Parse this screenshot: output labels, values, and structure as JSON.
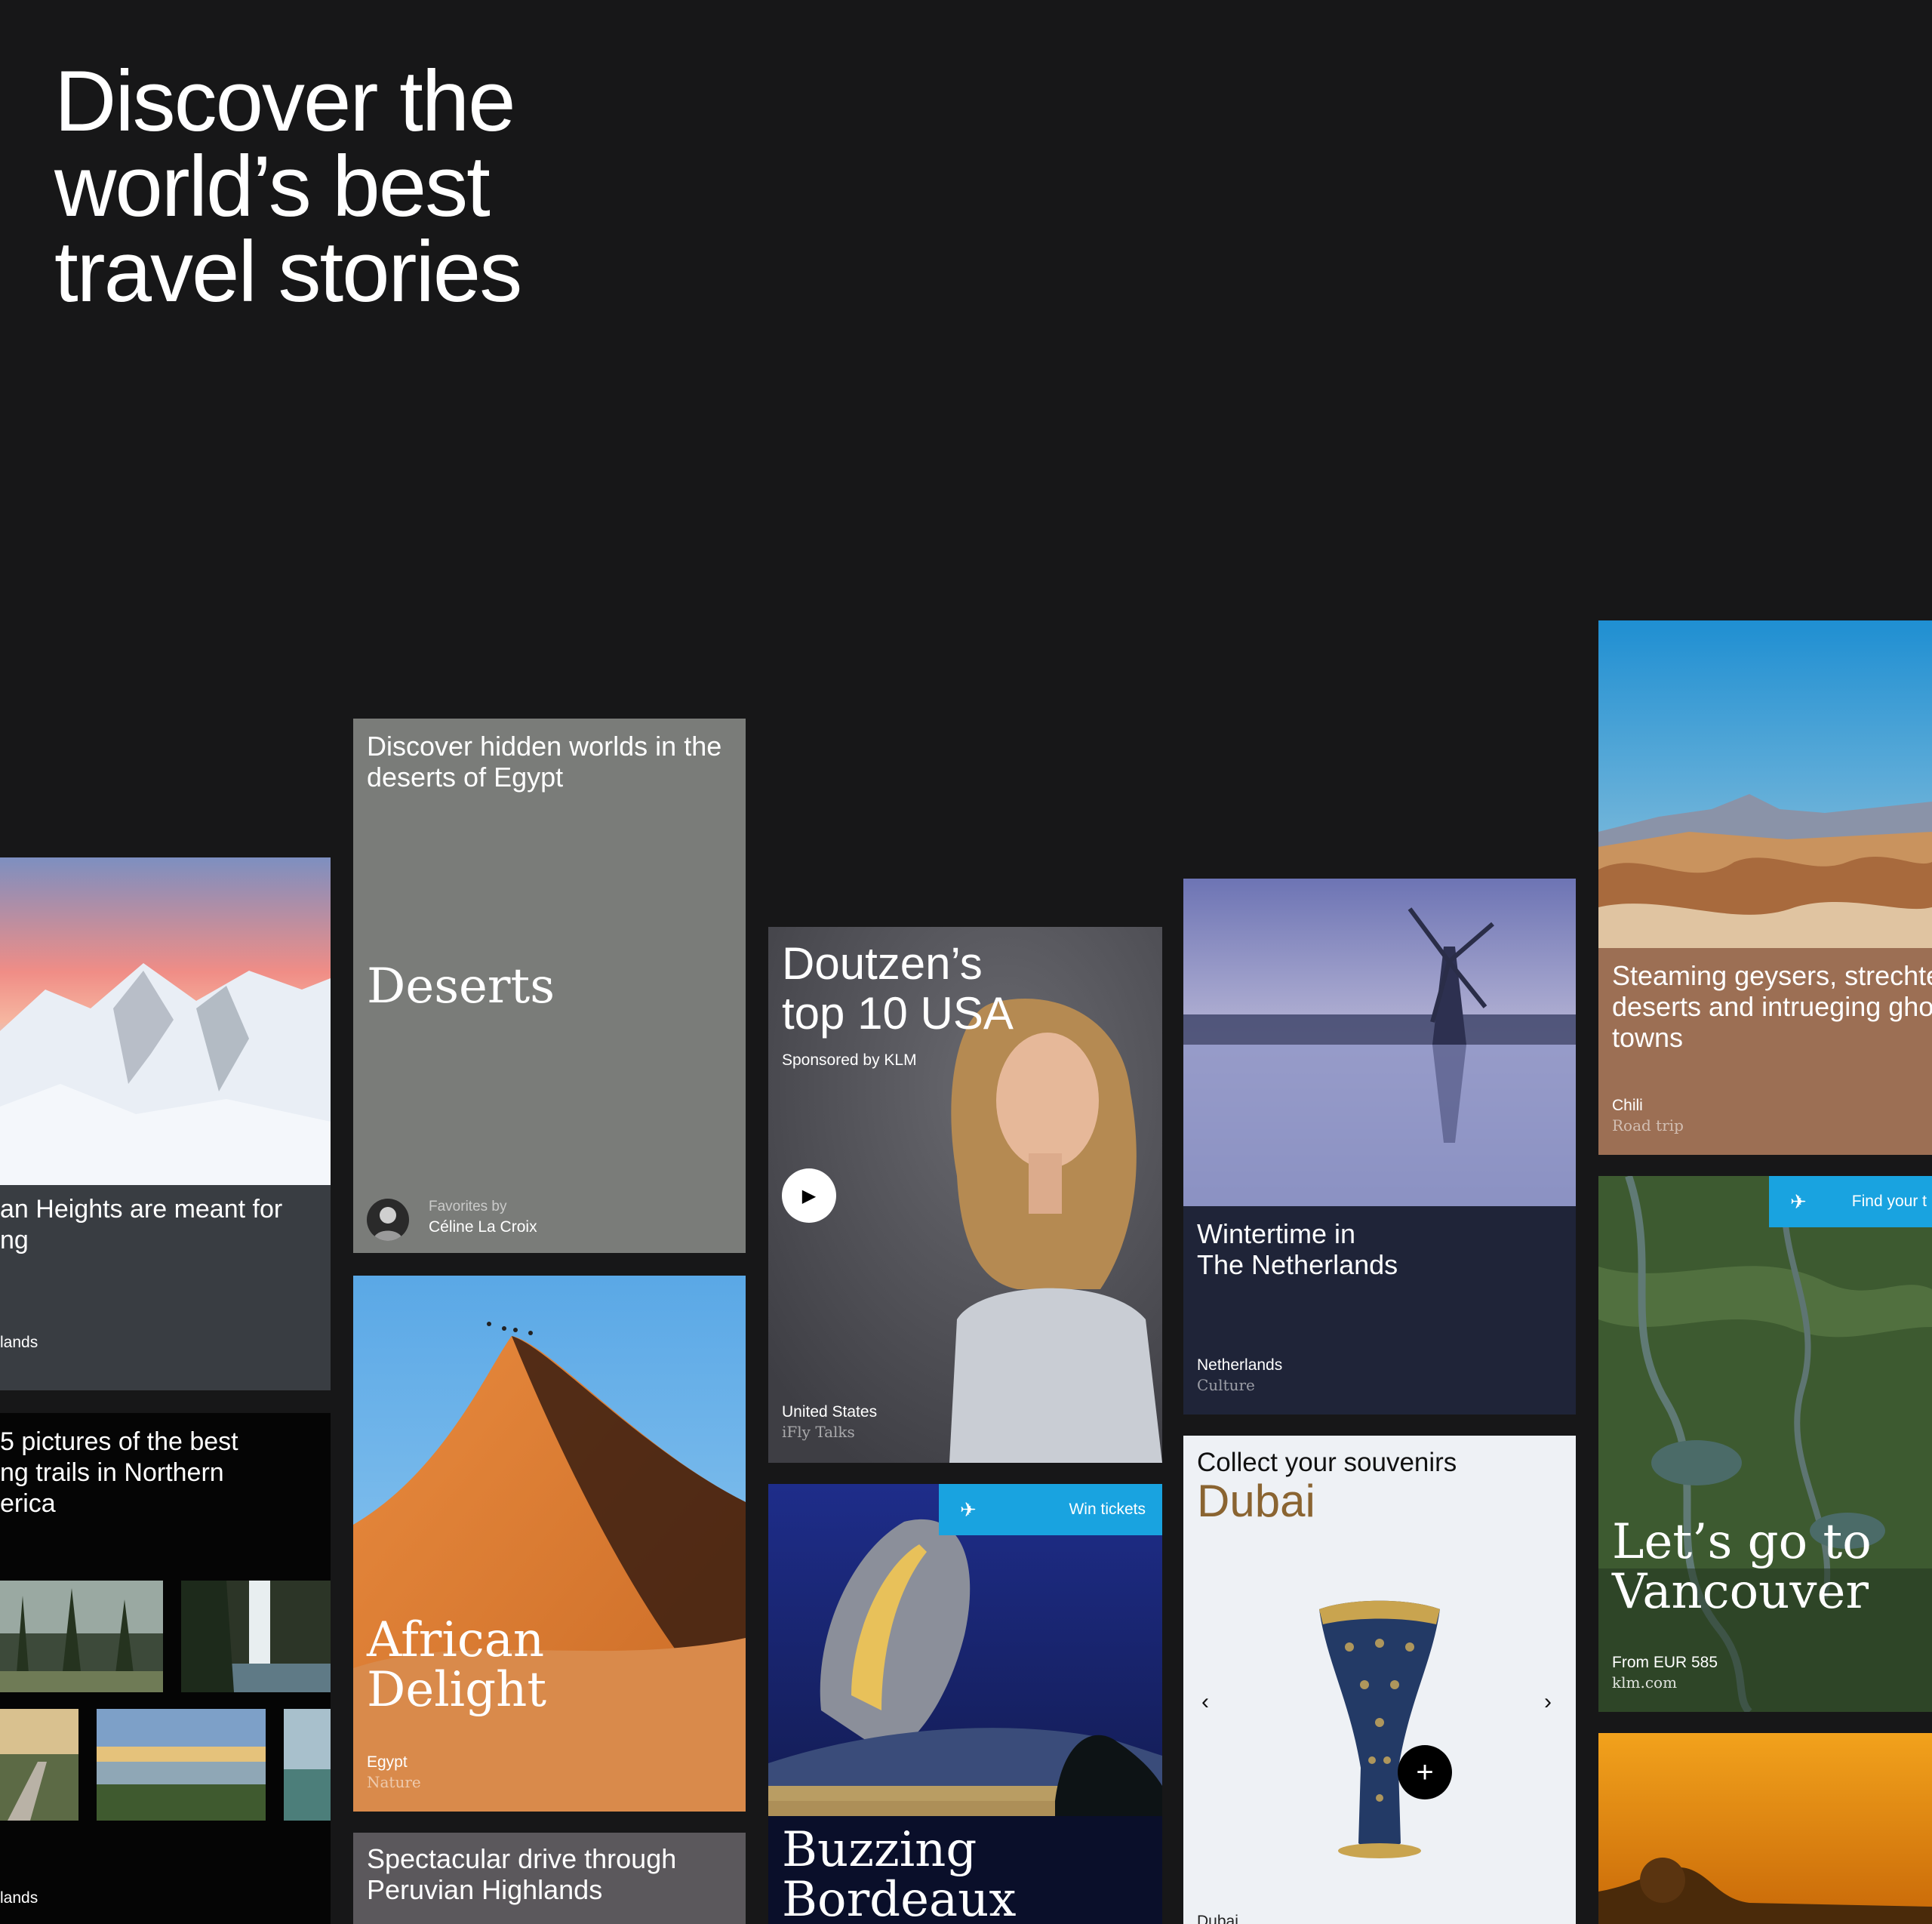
{
  "hero": {
    "title": "Discover the\nworld’s best\ntravel stories"
  },
  "cards": {
    "heights": {
      "title": "an Heights are meant for\nng",
      "location": "lands"
    },
    "trails": {
      "title": "5 pictures of the best\nng trails in Northern\nerica",
      "location": "lands"
    },
    "deserts": {
      "intro": "Discover hidden worlds in the\ndeserts of Egypt",
      "title": "Deserts",
      "favorites_label": "Favorites by",
      "author": "Céline La Croix"
    },
    "african": {
      "title": "African\nDelight",
      "location": "Egypt",
      "category": "Nature"
    },
    "peru": {
      "title": "Spectacular drive through\nPeruvian Highlands"
    },
    "doutzen": {
      "title": "Doutzen’s\ntop 10 USA",
      "sponsor": "Sponsored by KLM",
      "location": "United States",
      "category": "iFly Talks",
      "play_icon": "play-icon"
    },
    "bordeaux": {
      "ribbon": "Win tickets",
      "title": "Buzzing\nBordeaux"
    },
    "netherlands": {
      "title": "Wintertime in\nThe Netherlands",
      "location": "Netherlands",
      "category": "Culture"
    },
    "dubai": {
      "kicker": "Collect your souvenirs",
      "title": "Dubai",
      "location": "Dubai",
      "accent": "#8a6431"
    },
    "chili": {
      "title": "Steaming geysers, strechte\ndeserts and intrueging gho\ntowns",
      "location": "Chili",
      "category": "Road trip"
    },
    "vancouver": {
      "ribbon": "Find your t",
      "title": "Let’s go to\nVancouver",
      "price": "From EUR 585",
      "site": "klm.com"
    }
  },
  "colors": {
    "background": "#171718",
    "ribbon": "#19a3e0",
    "deserts_card": "#7a7c79",
    "netherlands_card": "#1f2438",
    "chili_card": "#9c6f54",
    "heights_card": "#393d42"
  }
}
